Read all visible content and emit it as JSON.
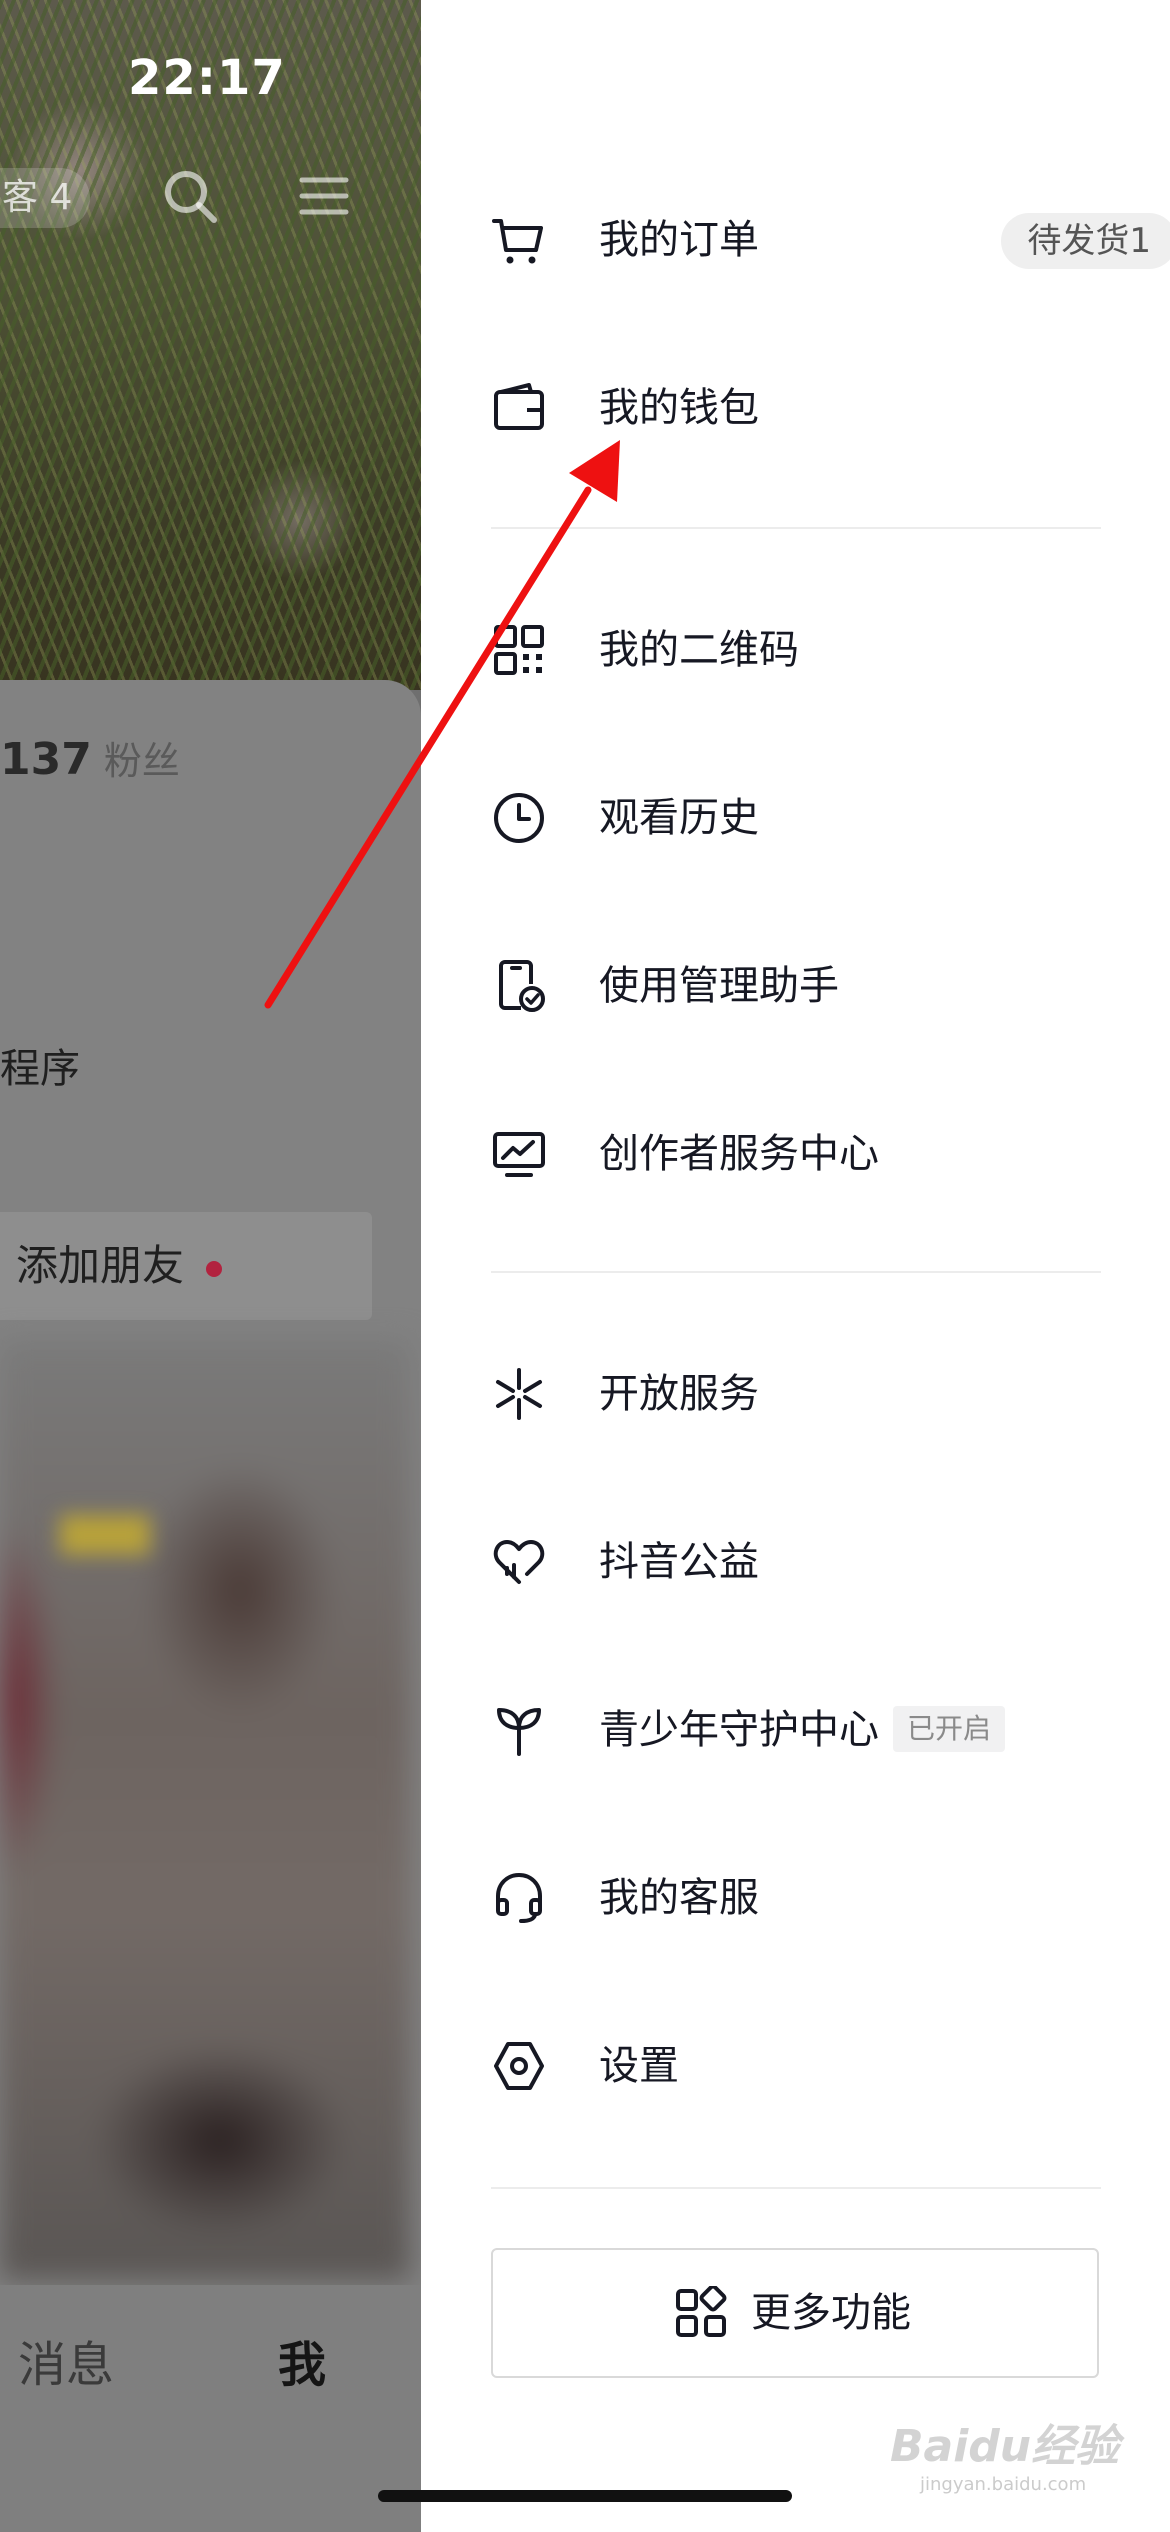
{
  "status_bar": {
    "time": "22:17"
  },
  "background_profile": {
    "visitor_label": "客 4",
    "followers_count": "137",
    "followers_label": "粉丝",
    "mini_program_text": "程序",
    "add_friend_label": "添加朋友",
    "tabs": {
      "messages": "消息",
      "me": "我"
    }
  },
  "drawer": {
    "group1": [
      {
        "label": "我的订单",
        "icon": "cart-icon",
        "badge": "待发货1"
      },
      {
        "label": "我的钱包",
        "icon": "wallet-icon"
      }
    ],
    "group2": [
      {
        "label": "我的二维码",
        "icon": "qrcode-icon"
      },
      {
        "label": "观看历史",
        "icon": "clock-icon"
      },
      {
        "label": "使用管理助手",
        "icon": "phone-check-icon"
      },
      {
        "label": "创作者服务中心",
        "icon": "monitor-chart-icon"
      }
    ],
    "group3": [
      {
        "label": "开放服务",
        "icon": "spark-icon"
      },
      {
        "label": "抖音公益",
        "icon": "heart-icon"
      },
      {
        "label": "青少年守护中心",
        "icon": "sprout-icon",
        "badge": "已开启"
      },
      {
        "label": "我的客服",
        "icon": "headset-icon"
      },
      {
        "label": "设置",
        "icon": "hexagon-nut-icon"
      }
    ],
    "more_button": "更多功能"
  },
  "watermark": {
    "text": "Baidu经验",
    "sub": "jingyan.baidu.com"
  },
  "annotation": {
    "color": "#ee1111"
  }
}
